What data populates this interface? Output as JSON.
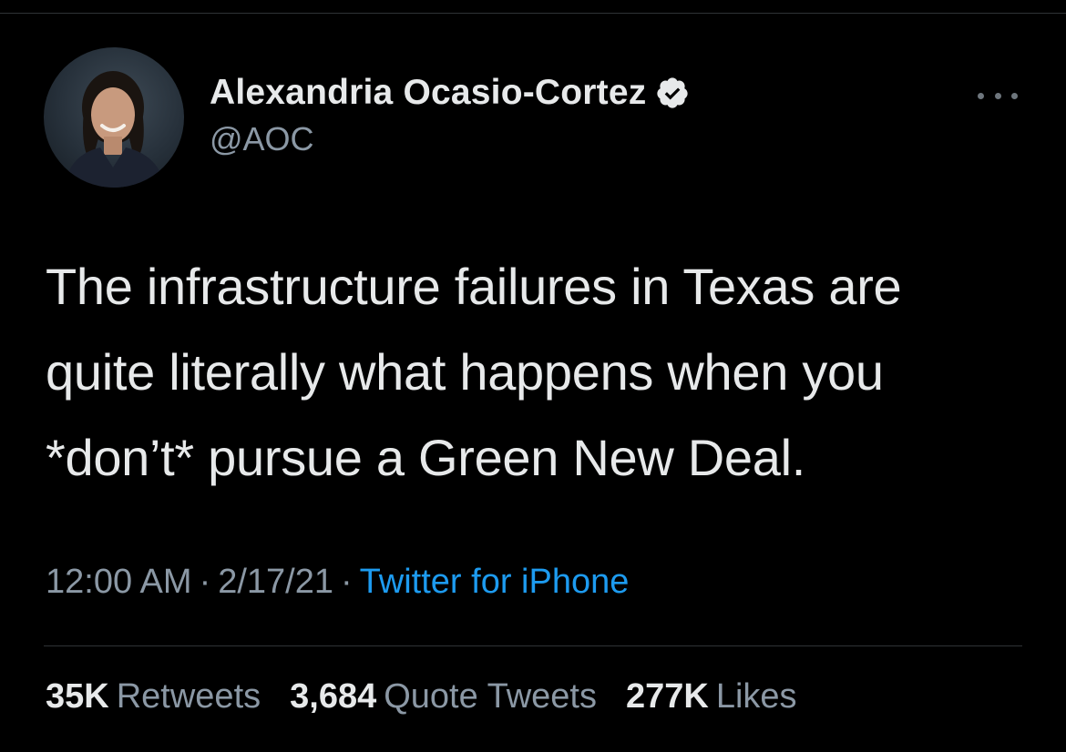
{
  "tweet": {
    "author": {
      "display_name": "Alexandria Ocasio-Cortez",
      "handle": "@AOC",
      "verified": true,
      "avatar_icon": "profile-photo"
    },
    "more_icon": "more-horizontal-icon",
    "text_lines": [
      "The infrastructure failures in Texas are",
      "quite literally what happens when you",
      "*don’t* pursue a Green New Deal."
    ],
    "meta": {
      "time": "12:00 AM",
      "separator": "·",
      "date": "2/17/21",
      "source": "Twitter for iPhone"
    },
    "stats": [
      {
        "count": "35K",
        "label": "Retweets"
      },
      {
        "count": "3,684",
        "label": "Quote Tweets"
      },
      {
        "count": "277K",
        "label": "Likes"
      }
    ]
  },
  "colors": {
    "background": "#000000",
    "text_primary": "#e7e9ea",
    "text_secondary": "#8b98a5",
    "link": "#1d9bf0",
    "divider": "#2f3336"
  }
}
